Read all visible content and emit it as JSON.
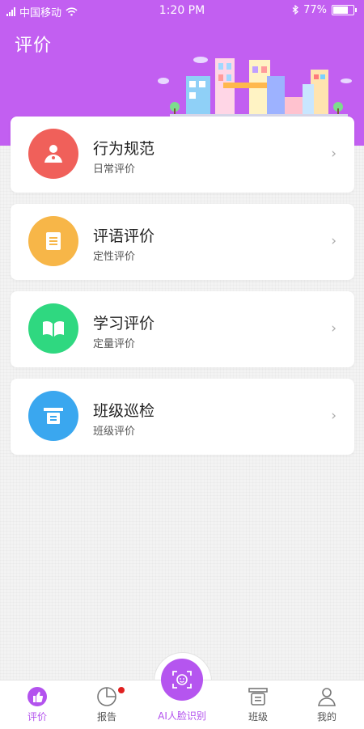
{
  "status_bar": {
    "carrier": "中国移动",
    "time": "1:20 PM",
    "battery": "77%"
  },
  "page": {
    "title": "评价"
  },
  "cards": [
    {
      "title": "行为规范",
      "subtitle": "日常评价",
      "icon": "person-badge-icon",
      "color": "#f0605a"
    },
    {
      "title": "评语评价",
      "subtitle": "定性评价",
      "icon": "document-icon",
      "color": "#f7b648"
    },
    {
      "title": "学习评价",
      "subtitle": "定量评价",
      "icon": "book-icon",
      "color": "#2fd880"
    },
    {
      "title": "班级巡检",
      "subtitle": "班级评价",
      "icon": "class-sign-icon",
      "color": "#3aa7ef"
    }
  ],
  "tabbar": {
    "tabs": [
      {
        "label": "评价",
        "icon": "thumbs-up-icon",
        "active": true
      },
      {
        "label": "报告",
        "icon": "pie-chart-icon",
        "badge": true
      },
      {
        "label": "AI人脸识别",
        "icon": "face-scan-icon"
      },
      {
        "label": "班级",
        "icon": "class-sign-icon"
      },
      {
        "label": "我的",
        "icon": "user-icon"
      }
    ]
  },
  "colors": {
    "accent": "#c25ff1",
    "badge": "#e02020"
  }
}
